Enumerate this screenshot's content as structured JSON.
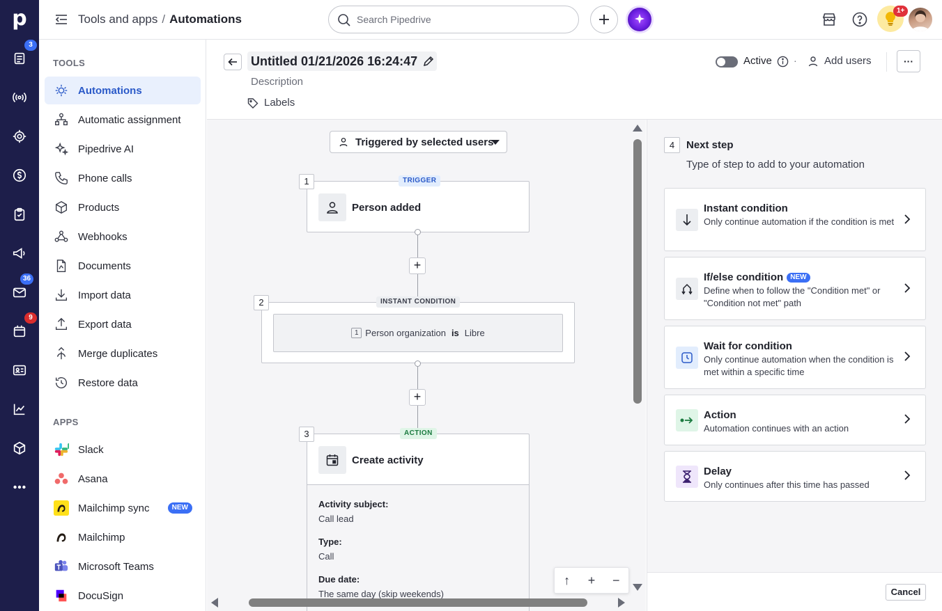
{
  "rail": {
    "logo": "p",
    "badges": {
      "leads": "3",
      "mail": "36",
      "calendar": "9"
    }
  },
  "header": {
    "breadcrumb_parent": "Tools and apps",
    "breadcrumb_separator": "/",
    "breadcrumb_current": "Automations",
    "search_placeholder": "Search Pipedrive",
    "notifications_badge": "1+"
  },
  "sidebar": {
    "tools_title": "TOOLS",
    "tools": [
      {
        "label": "Automations",
        "icon": "automation-icon",
        "active": true
      },
      {
        "label": "Automatic assignment",
        "icon": "assignment-icon"
      },
      {
        "label": "Pipedrive AI",
        "icon": "sparkle-icon"
      },
      {
        "label": "Phone calls",
        "icon": "phone-icon"
      },
      {
        "label": "Products",
        "icon": "box-icon"
      },
      {
        "label": "Webhooks",
        "icon": "webhook-icon"
      },
      {
        "label": "Documents",
        "icon": "document-icon"
      },
      {
        "label": "Import data",
        "icon": "import-icon"
      },
      {
        "label": "Export data",
        "icon": "export-icon"
      },
      {
        "label": "Merge duplicates",
        "icon": "merge-icon"
      },
      {
        "label": "Restore data",
        "icon": "restore-icon"
      }
    ],
    "apps_title": "APPS",
    "apps": [
      {
        "label": "Slack",
        "icon": "slack-icon"
      },
      {
        "label": "Asana",
        "icon": "asana-icon"
      },
      {
        "label": "Mailchimp sync",
        "icon": "mailchimp-icon",
        "badge": "NEW"
      },
      {
        "label": "Mailchimp",
        "icon": "mailchimp-icon"
      },
      {
        "label": "Microsoft Teams",
        "icon": "teams-icon"
      },
      {
        "label": "DocuSign",
        "icon": "docusign-icon"
      }
    ]
  },
  "automation": {
    "title": "Untitled 01/21/2026 16:24:47",
    "description_placeholder": "Description",
    "labels_label": "Labels",
    "active_label": "Active",
    "active": false,
    "dot": "·",
    "add_users_label": "Add users",
    "more_label": "···"
  },
  "canvas": {
    "trigger_selector": "Triggered by selected users",
    "steps": [
      {
        "number": "1",
        "tag": "TRIGGER",
        "title": "Person added"
      },
      {
        "number": "2",
        "tag": "INSTANT CONDITION",
        "condition": {
          "index": "1",
          "field": "Person organization",
          "operator": "is",
          "value": "Libre"
        }
      },
      {
        "number": "3",
        "tag": "ACTION",
        "title": "Create activity",
        "details": [
          {
            "label": "Activity subject:",
            "value": "Call lead"
          },
          {
            "label": "Type:",
            "value": "Call"
          },
          {
            "label": "Due date:",
            "value": "The same day (skip weekends)"
          }
        ]
      }
    ],
    "zoom_controls": [
      "↑",
      "+",
      "−"
    ]
  },
  "next_step": {
    "number": "4",
    "title": "Next step",
    "subtitle": "Type of step to add to your automation",
    "options": [
      {
        "title": "Instant condition",
        "desc": "Only continue automation if the condition is met",
        "icon": "arrow-down-icon",
        "color": "#eceef1"
      },
      {
        "title": "If/else condition",
        "badge": "NEW",
        "desc": "Define when to follow the \"Condition met\" or \"Condition not met\" path",
        "icon": "branch-icon",
        "color": "#eceef1"
      },
      {
        "title": "Wait for condition",
        "desc": "Only continue automation when the condition is met within a specific time",
        "icon": "clock-icon",
        "color": "#e2edfd"
      },
      {
        "title": "Action",
        "desc": "Automation continues with an action",
        "icon": "action-arrow-icon",
        "color": "#dff5e7"
      },
      {
        "title": "Delay",
        "desc": "Only continues after this time has passed",
        "icon": "hourglass-icon",
        "color": "#efe6fb"
      }
    ],
    "cancel_label": "Cancel"
  },
  "colors": {
    "rail": "#1d1e4a",
    "accent": "#2a59c8",
    "badge_blue": "#3b6ff5",
    "badge_red": "#d92d2d"
  }
}
